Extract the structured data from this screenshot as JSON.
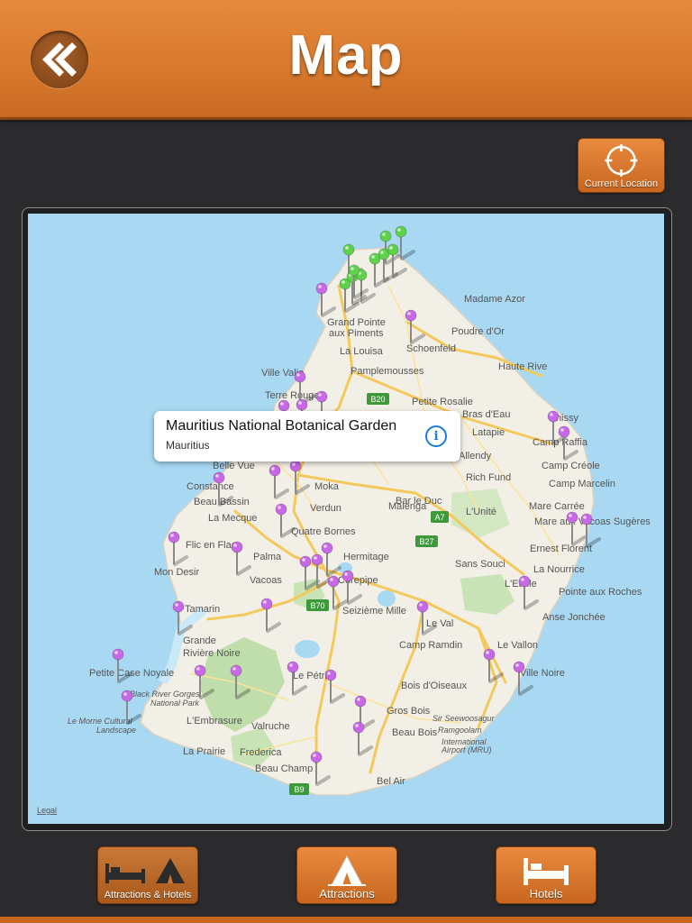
{
  "header": {
    "title": "Map",
    "back_icon": "double-chevron-left-icon"
  },
  "map_controls": {
    "current_location_label": "Current Location",
    "icon": "crosshair-icon"
  },
  "callout": {
    "title": "Mauritius National Botanical Garden",
    "subtitle": "Mauritius",
    "icon": "info-icon"
  },
  "map": {
    "legal_label": "Legal",
    "places": [
      "Madame Azor",
      "Grand Pointe",
      "aux Piments",
      "Poudre d'Or",
      "La Louisa",
      "Schoenfeld",
      "Haute Rive",
      "Pamplemousses",
      "Ville Valio",
      "Terre Rouge",
      "Petite Rosalie",
      "Bras d'Eau",
      "Latapie",
      "Camp Raffia",
      "Chissy",
      "Allendy",
      "Belle Vue",
      "Constance",
      "Moka",
      "Camp Créole",
      "Rich Fund",
      "Camp Marcelin",
      "Malenga",
      "Beau Bassin",
      "Bar le Duc",
      "Mare Carrée",
      "La Mecque",
      "Verdun",
      "L'Unité",
      "Mare aux Vacoas Sugères",
      "Flic en Flac",
      "Quatre Bornes",
      "Ernest Florent",
      "Palma",
      "Hermitage",
      "Mon Desir",
      "Sans Souci",
      "La Nourrice",
      "Vacoas",
      "Curepipe",
      "L'Etoile",
      "Pointe aux Roches",
      "Seizième Mille",
      "Tamarin",
      "Le Val",
      "Anse Jonchée",
      "Grande",
      "Rivière Noire",
      "Camp Ramdin",
      "Le Vallon",
      "Petite Case Noyale",
      "Le Pétrin",
      "Ville Noire",
      "Bois d'Oiseaux",
      "L'Embrasure",
      "Gros Bois",
      "Valruche",
      "Beau Bois",
      "Frederica",
      "La Prairie",
      "Beau Champ",
      "Bel Air",
      "Sir Seewoosagur",
      "Ramgoolam",
      "International",
      "Airport (MRU)",
      "Black River Gorges",
      "National Park",
      "Le Morne Cultural",
      "Landscape"
    ],
    "roads": [
      "B20",
      "A7",
      "B27",
      "B70",
      "B9"
    ],
    "colors": {
      "sea": "#a8d8f2",
      "land": "#f2efe6",
      "park": "#bfdeab",
      "road": "#f4c95c",
      "pin_purple": "#c768e6",
      "pin_green": "#5ed24a"
    }
  },
  "tabs": [
    {
      "label": "Attractions & Hotels",
      "icons": [
        "bed-icon",
        "tent-icon"
      ]
    },
    {
      "label": "Attractions",
      "icons": [
        "tent-icon"
      ]
    },
    {
      "label": "Hotels",
      "icons": [
        "bed-icon"
      ]
    }
  ]
}
